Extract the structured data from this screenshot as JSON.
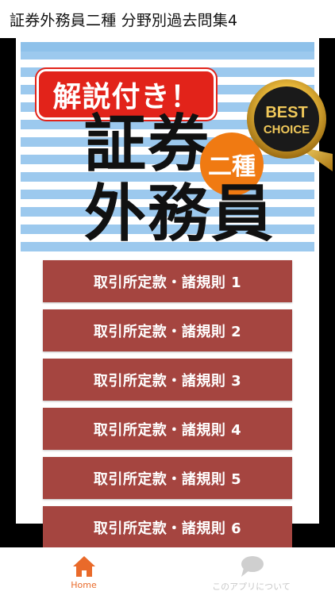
{
  "appbar": {
    "title": "証券外務員二種 分野別過去問集4"
  },
  "banner": {
    "tag": "解説付き！",
    "title_line1": "証券",
    "grade": "二種",
    "title_line2": "外務員",
    "badge_line1": "BEST",
    "badge_line2": "CHOICE"
  },
  "menu": {
    "items": [
      {
        "label": "取引所定款・諸規則 1"
      },
      {
        "label": "取引所定款・諸規則 2"
      },
      {
        "label": "取引所定款・諸規則 3"
      },
      {
        "label": "取引所定款・諸規則 4"
      },
      {
        "label": "取引所定款・諸規則 5"
      },
      {
        "label": "取引所定款・諸規則 6"
      }
    ]
  },
  "nav": {
    "home_label": "Home",
    "about_label": "このアプリについて",
    "home_icon": "home-icon",
    "about_icon": "chat-bubble-icon"
  },
  "colors": {
    "button_bg": "#a54540",
    "nav_active": "#e96a2a",
    "nav_inactive": "#c8c8c8",
    "tag_bg": "#e2231a",
    "grade_bg": "#f07a12",
    "stripe": "#9cc9ee"
  }
}
